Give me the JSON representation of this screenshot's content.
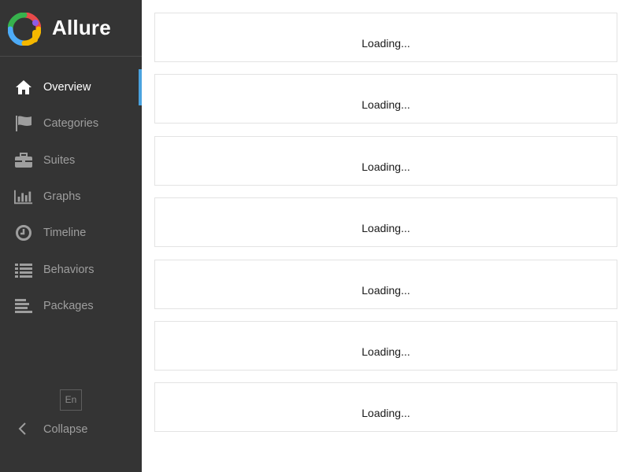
{
  "app": {
    "name": "Allure"
  },
  "sidebar": {
    "items": [
      {
        "label": "Overview",
        "icon": "home-icon",
        "active": true
      },
      {
        "label": "Categories",
        "icon": "flag-icon",
        "active": false
      },
      {
        "label": "Suites",
        "icon": "briefcase-icon",
        "active": false
      },
      {
        "label": "Graphs",
        "icon": "bar-chart-icon",
        "active": false
      },
      {
        "label": "Timeline",
        "icon": "clock-icon",
        "active": false
      },
      {
        "label": "Behaviors",
        "icon": "list-icon",
        "active": false
      },
      {
        "label": "Packages",
        "icon": "align-left-icon",
        "active": false
      }
    ],
    "language": "En",
    "collapse_label": "Collapse"
  },
  "widgets": [
    {
      "status": "Loading..."
    },
    {
      "status": "Loading..."
    },
    {
      "status": "Loading..."
    },
    {
      "status": "Loading..."
    },
    {
      "status": "Loading..."
    },
    {
      "status": "Loading..."
    },
    {
      "status": "Loading..."
    }
  ],
  "colors": {
    "sidebar_bg": "#343434",
    "active_indicator": "#4aa3df",
    "inactive_text": "#9e9e9e",
    "active_text": "#ffffff"
  }
}
